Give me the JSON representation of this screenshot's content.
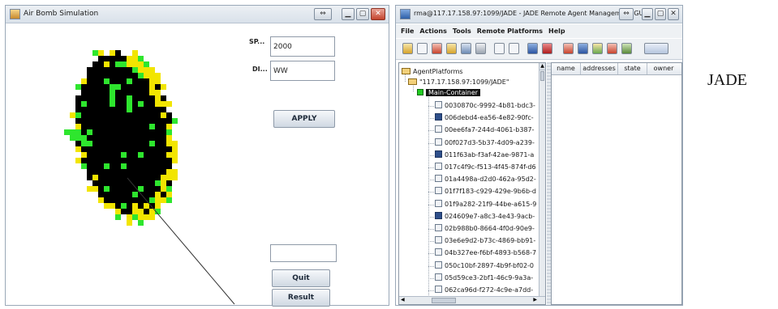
{
  "air_window": {
    "title": "Air Bomb Simulation",
    "title_buttons": [
      "⇔",
      "▁",
      "▢",
      "✕"
    ],
    "speed_label": "SP...",
    "speed_value": "2000",
    "direction_label": "DI...",
    "direction_value": "WW",
    "apply_label": "APPLY",
    "empty_field_value": "",
    "quit_label": "Quit",
    "result_label": "Result",
    "colors": {
      "black": "#000000",
      "yellow": "#f2e500",
      "green": "#2ee62e"
    }
  },
  "jade_window": {
    "title": "rma@117.17.158.97:1099/JADE - JADE Remote Agent Management GUI",
    "title_buttons": [
      "⇔",
      "▁",
      "▢",
      "✕"
    ],
    "menu": [
      "File",
      "Actions",
      "Tools",
      "Remote Platforms",
      "Help"
    ],
    "tree": {
      "root": "AgentPlatforms",
      "platform": "\"117.17.158.97:1099/JADE\"",
      "container": "Main-Container",
      "agents": [
        {
          "name": "0030870c-9992-4b81-bdc3-",
          "dark": false
        },
        {
          "name": "006debd4-ea56-4e82-90fc-",
          "dark": true
        },
        {
          "name": "00ee6fa7-244d-4061-b387-",
          "dark": false
        },
        {
          "name": "00f027d3-5b37-4d09-a239-",
          "dark": false
        },
        {
          "name": "011f63ab-f3af-42ae-9871-a",
          "dark": true
        },
        {
          "name": "017c4f9c-f513-4f45-874f-d6",
          "dark": false
        },
        {
          "name": "01a4498a-d2d0-462a-95d2-",
          "dark": false
        },
        {
          "name": "01f7f183-c929-429e-9b6b-d",
          "dark": false
        },
        {
          "name": "01f9a282-21f9-44be-a615-9",
          "dark": false
        },
        {
          "name": "024609e7-a8c3-4e43-9acb-",
          "dark": true
        },
        {
          "name": "02b988b0-8664-4f0d-90e9-",
          "dark": false
        },
        {
          "name": "03e6e9d2-b73c-4869-bb91-",
          "dark": false
        },
        {
          "name": "04b327ee-f6bf-4893-b568-7",
          "dark": false
        },
        {
          "name": "050c10bf-2897-4b9f-bf02-0",
          "dark": false
        },
        {
          "name": "05d59ce3-2bf1-46c9-9a3a-",
          "dark": false
        },
        {
          "name": "062ca96d-f272-4c9e-a7dd-",
          "dark": false
        }
      ]
    },
    "table_headers": [
      "name",
      "addresses",
      "state",
      "owner"
    ]
  },
  "side_label": "JADE"
}
